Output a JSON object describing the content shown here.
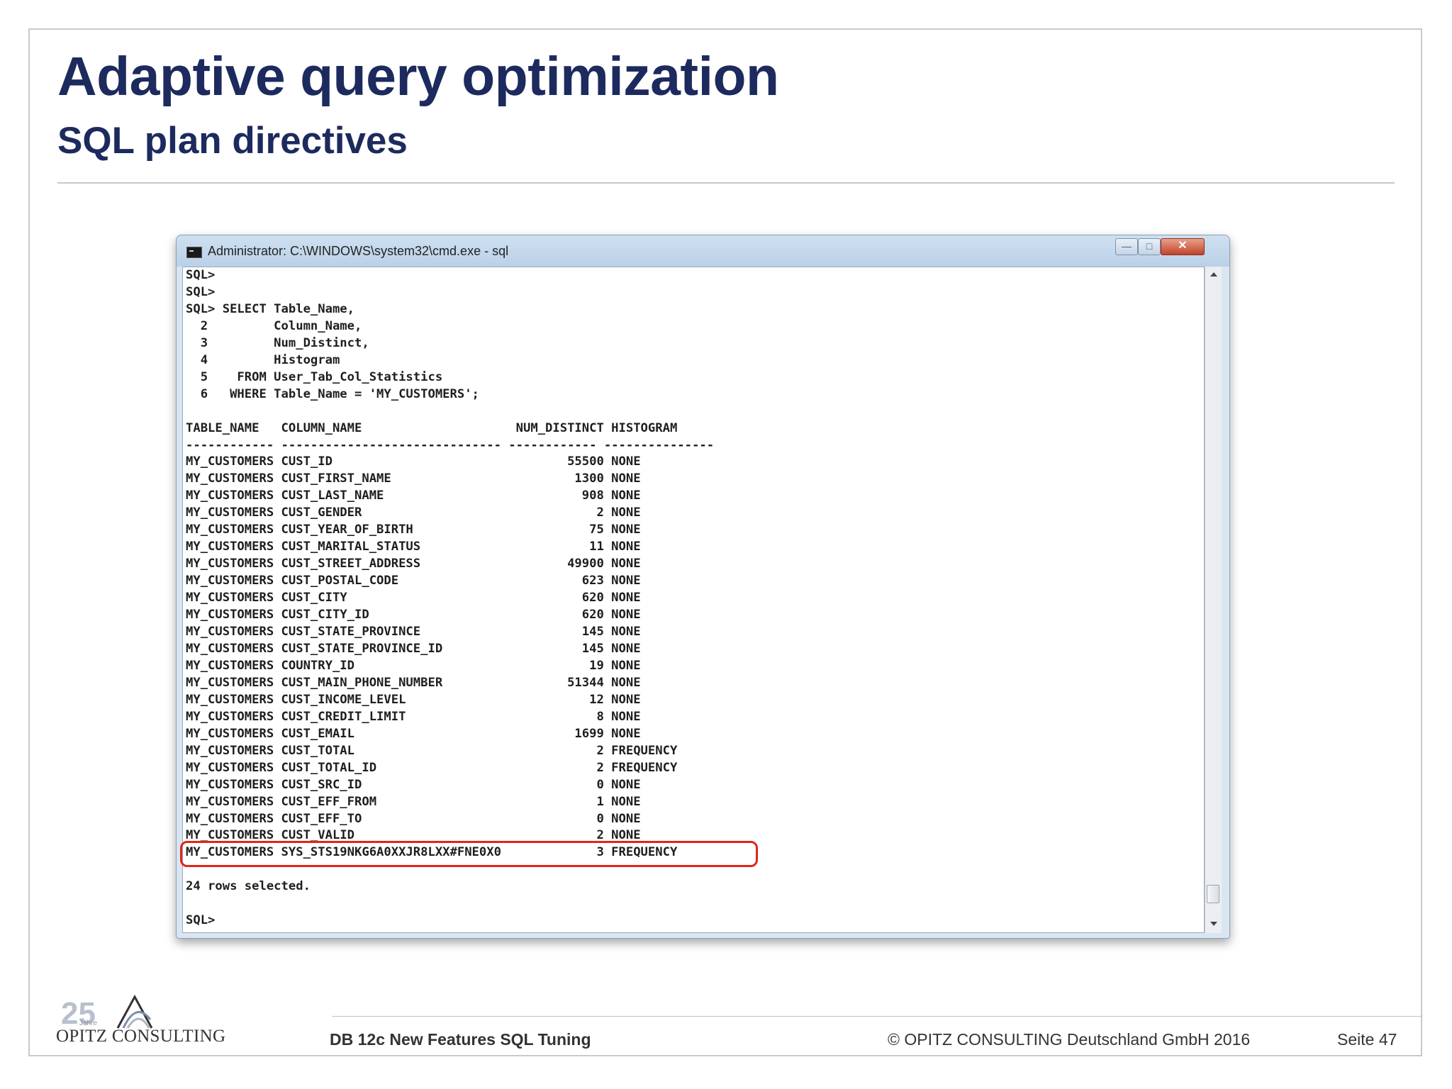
{
  "slide": {
    "title": "Adaptive query optimization",
    "subtitle": "SQL plan directives"
  },
  "window": {
    "title": "Administrator: C:\\WINDOWS\\system32\\cmd.exe - sql",
    "console_lines": [
      "SQL>",
      "SQL>",
      "SQL> SELECT Table_Name,",
      "  2         Column_Name,",
      "  3         Num_Distinct,",
      "  4         Histogram",
      "  5    FROM User_Tab_Col_Statistics",
      "  6   WHERE Table_Name = 'MY_CUSTOMERS';",
      "",
      "TABLE_NAME   COLUMN_NAME                     NUM_DISTINCT HISTOGRAM",
      "------------ ------------------------------ ------------ ---------------",
      "MY_CUSTOMERS CUST_ID                                55500 NONE",
      "MY_CUSTOMERS CUST_FIRST_NAME                         1300 NONE",
      "MY_CUSTOMERS CUST_LAST_NAME                           908 NONE",
      "MY_CUSTOMERS CUST_GENDER                                2 NONE",
      "MY_CUSTOMERS CUST_YEAR_OF_BIRTH                        75 NONE",
      "MY_CUSTOMERS CUST_MARITAL_STATUS                       11 NONE",
      "MY_CUSTOMERS CUST_STREET_ADDRESS                    49900 NONE",
      "MY_CUSTOMERS CUST_POSTAL_CODE                         623 NONE",
      "MY_CUSTOMERS CUST_CITY                                620 NONE",
      "MY_CUSTOMERS CUST_CITY_ID                             620 NONE",
      "MY_CUSTOMERS CUST_STATE_PROVINCE                      145 NONE",
      "MY_CUSTOMERS CUST_STATE_PROVINCE_ID                   145 NONE",
      "MY_CUSTOMERS COUNTRY_ID                                19 NONE",
      "MY_CUSTOMERS CUST_MAIN_PHONE_NUMBER                 51344 NONE",
      "MY_CUSTOMERS CUST_INCOME_LEVEL                         12 NONE",
      "MY_CUSTOMERS CUST_CREDIT_LIMIT                          8 NONE",
      "MY_CUSTOMERS CUST_EMAIL                              1699 NONE",
      "MY_CUSTOMERS CUST_TOTAL                                 2 FREQUENCY",
      "MY_CUSTOMERS CUST_TOTAL_ID                              2 FREQUENCY",
      "MY_CUSTOMERS CUST_SRC_ID                                0 NONE",
      "MY_CUSTOMERS CUST_EFF_FROM                              1 NONE",
      "MY_CUSTOMERS CUST_EFF_TO                                0 NONE",
      "MY_CUSTOMERS CUST_VALID                                 2 NONE",
      "MY_CUSTOMERS SYS_STS19NKG6A0XXJR8LXX#FNE0X0             3 FREQUENCY",
      "",
      "24 rows selected.",
      "",
      "SQL>"
    ]
  },
  "logo": {
    "anniversary": "25",
    "jahre": "Jahre",
    "name": "OPITZ CONSULTING"
  },
  "footer": {
    "left": "DB 12c New Features SQL Tuning",
    "copyright": "© OPITZ CONSULTING Deutschland GmbH 2016",
    "page": "Seite 47"
  },
  "colors": {
    "title": "#1d2a5e",
    "highlight": "#e0251b"
  },
  "icons": [
    "cmd-icon",
    "minimize-icon",
    "maximize-icon",
    "close-icon",
    "scroll-up-icon",
    "scroll-down-icon"
  ]
}
